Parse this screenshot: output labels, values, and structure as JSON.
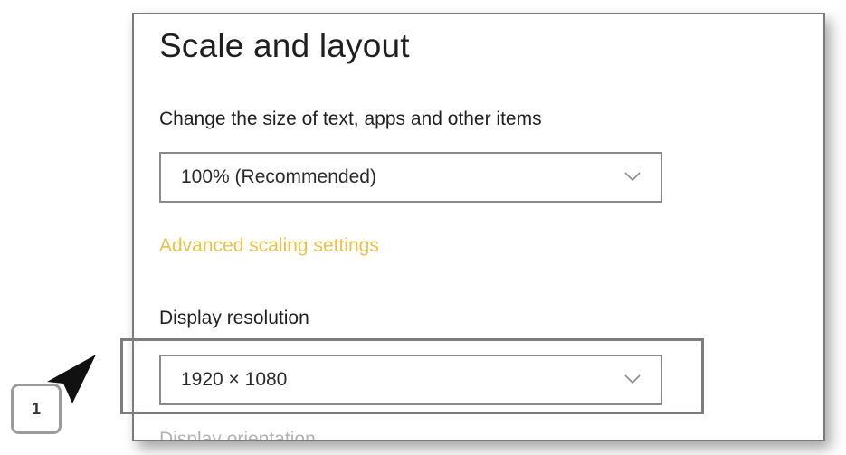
{
  "panel": {
    "title": "Scale and layout",
    "size_label": "Change the size of text, apps and other items",
    "scale_dropdown": {
      "value": "100% (Recommended)"
    },
    "advanced_link": "Advanced scaling settings",
    "resolution_label": "Display resolution",
    "resolution_dropdown": {
      "value": "1920 × 1080"
    },
    "cutoff_label": "Display orientation"
  },
  "callout": {
    "number": "1"
  },
  "colors": {
    "link": "#e6c34a",
    "highlight_border": "#7d7d7d",
    "arrow": "#111111"
  },
  "icons": {
    "dropdown": "chevron-down-icon",
    "pointer": "arrow-pointer-icon"
  }
}
